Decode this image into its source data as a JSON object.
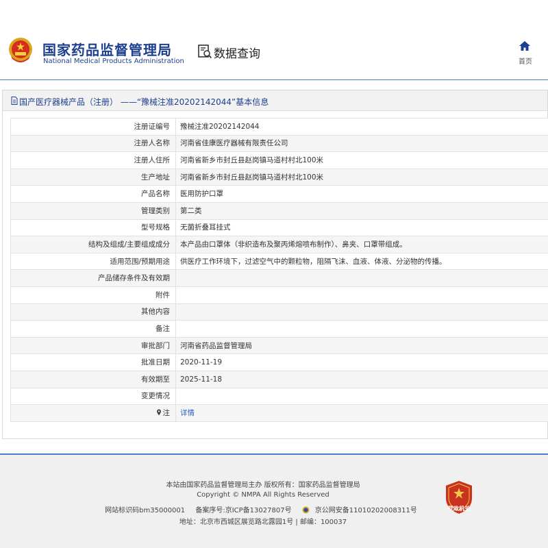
{
  "header": {
    "org_name_cn": "国家药品监督管理局",
    "org_name_en": "National Medical Products Administration",
    "section_label": "数据查询",
    "home_label": "首页"
  },
  "panel": {
    "title": "国产医疗器械产品（注册） ——“豫械注准20202142044”基本信息",
    "rows": [
      {
        "label": "注册证编号",
        "value": "豫械注准20202142044"
      },
      {
        "label": "注册人名称",
        "value": "河南省佳康医疗器械有限责任公司"
      },
      {
        "label": "注册人住所",
        "value": "河南省新乡市封丘县赵岗镇马道村村北100米"
      },
      {
        "label": "生产地址",
        "value": "河南省新乡市封丘县赵岗镇马道村村北100米"
      },
      {
        "label": "产品名称",
        "value": "医用防护口罩"
      },
      {
        "label": "管理类别",
        "value": "第二类"
      },
      {
        "label": "型号规格",
        "value": "无菌折叠耳挂式"
      },
      {
        "label": "结构及组成/主要组成成分",
        "value": "本产品由口罩体（非织造布及聚丙烯熔喷布制作）、鼻夹、口罩带组成。"
      },
      {
        "label": "适用范围/预期用途",
        "value": "供医疗工作环境下，过滤空气中的颗粒物，阻隔飞沫、血液、体液、分泌物的传播。"
      },
      {
        "label": "产品储存条件及有效期",
        "value": ""
      },
      {
        "label": "附件",
        "value": ""
      },
      {
        "label": "其他内容",
        "value": ""
      },
      {
        "label": "备注",
        "value": ""
      },
      {
        "label": "审批部门",
        "value": "河南省药品监督管理局"
      },
      {
        "label": "批准日期",
        "value": "2020-11-19"
      },
      {
        "label": "有效期至",
        "value": "2025-11-18"
      },
      {
        "label": "变更情况",
        "value": ""
      },
      {
        "label": "注",
        "value": "详情"
      }
    ]
  },
  "footer": {
    "line1": "本站由国家药品监督管理局主办 版权所有：国家药品监督管理局",
    "line2": "Copyright © NMPA All Rights Reserved",
    "site_id": "网站标识码bm35000001",
    "icp": "备案序号:京ICP备13027807号",
    "police": "京公网安备11010202008311号",
    "address": "地址：北京市西城区展览路北露园1号 | 邮编：100037",
    "badge_text": "党政机关"
  },
  "colors": {
    "brand_blue": "#1d3f8f",
    "rule_blue": "#4a7bc8",
    "link_blue": "#2b63c6",
    "badge_red": "#c8321e"
  }
}
